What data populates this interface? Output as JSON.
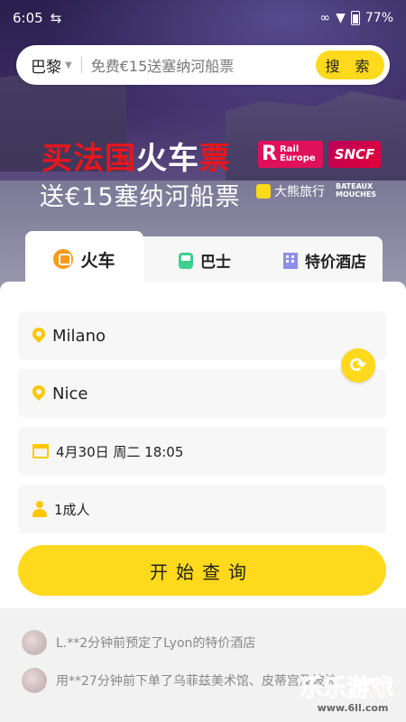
{
  "status_bar": {
    "time": "6:05",
    "battery": "77%"
  },
  "search": {
    "city": "巴黎",
    "placeholder": "免费€15送塞纳河船票",
    "button_label": "搜 索"
  },
  "banner": {
    "headline_red1": "买法国",
    "headline_white": "火车",
    "headline_red2": "票",
    "subline": "送€15塞纳河船票",
    "logo_rail_line1": "Rail",
    "logo_rail_line2": "Europe",
    "logo_sncf": "SNCF",
    "logo_daxiong": "大熊旅行",
    "logo_bateaux_line1": "BATEAUX",
    "logo_bateaux_line2": "MOUCHES"
  },
  "tabs": [
    {
      "label": "火车",
      "icon": "train-icon",
      "active": true
    },
    {
      "label": "巴士",
      "icon": "bus-icon",
      "active": false
    },
    {
      "label": "特价酒店",
      "icon": "hotel-icon",
      "active": false
    }
  ],
  "form": {
    "from": "Milano",
    "to": "Nice",
    "datetime": "4月30日 周二 18:05",
    "passengers": "1成人",
    "submit_label": "开始查询"
  },
  "notices": [
    "L.**2分钟前预定了Lyon的特价酒店",
    "用**27分钟前下单了乌菲兹美术馆、皮蒂宫及波波"
  ],
  "watermark": {
    "title": "乐乐游戏",
    "url": "www.6ll.com"
  },
  "colors": {
    "accent": "#ffd91c",
    "banner_red": "#e8161c"
  }
}
